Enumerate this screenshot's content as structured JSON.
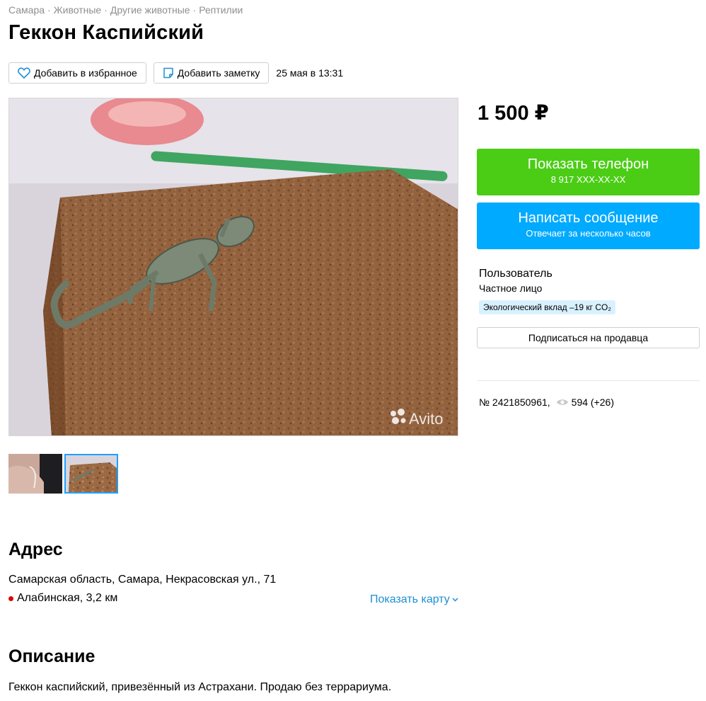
{
  "breadcrumb": [
    "Самара",
    "Животные",
    "Другие животные",
    "Рептилии"
  ],
  "title": "Геккон Каспийский",
  "actions": {
    "favorite_label": "Добавить в избранное",
    "note_label": "Добавить заметку",
    "date": "25 мая в 13:31"
  },
  "gallery": {
    "watermark": "Avito",
    "thumb_count": 2,
    "active_thumb": 1
  },
  "price": "1 500 ₽",
  "contact": {
    "phone_label": "Показать телефон",
    "phone_number": "8 917 XXX-XX-XX",
    "message_label": "Написать сообщение",
    "message_sub": "Отвечает за несколько часов"
  },
  "seller": {
    "name": "Пользователь",
    "type": "Частное лицо",
    "eco_badge": "Экологический вклад –19 кг CO₂",
    "subscribe_label": "Подписаться на продавца"
  },
  "meta": {
    "ad_number": "№ 2421850961,",
    "views": "594 (+26)"
  },
  "address": {
    "heading": "Адрес",
    "line": "Самарская область, Самара, Некрасовская ул., 71",
    "metro": "Алабинская, 3,2 км",
    "map_link": "Показать карту"
  },
  "description": {
    "heading": "Описание",
    "text": "Геккон каспийский, привезённый из Астрахани. Продаю без террариума."
  },
  "colors": {
    "green": "#4bcd16",
    "blue": "#00aaff",
    "link": "#1b8fd4",
    "metro": "#d40a0a",
    "eco_bg": "#d9f1ff"
  }
}
